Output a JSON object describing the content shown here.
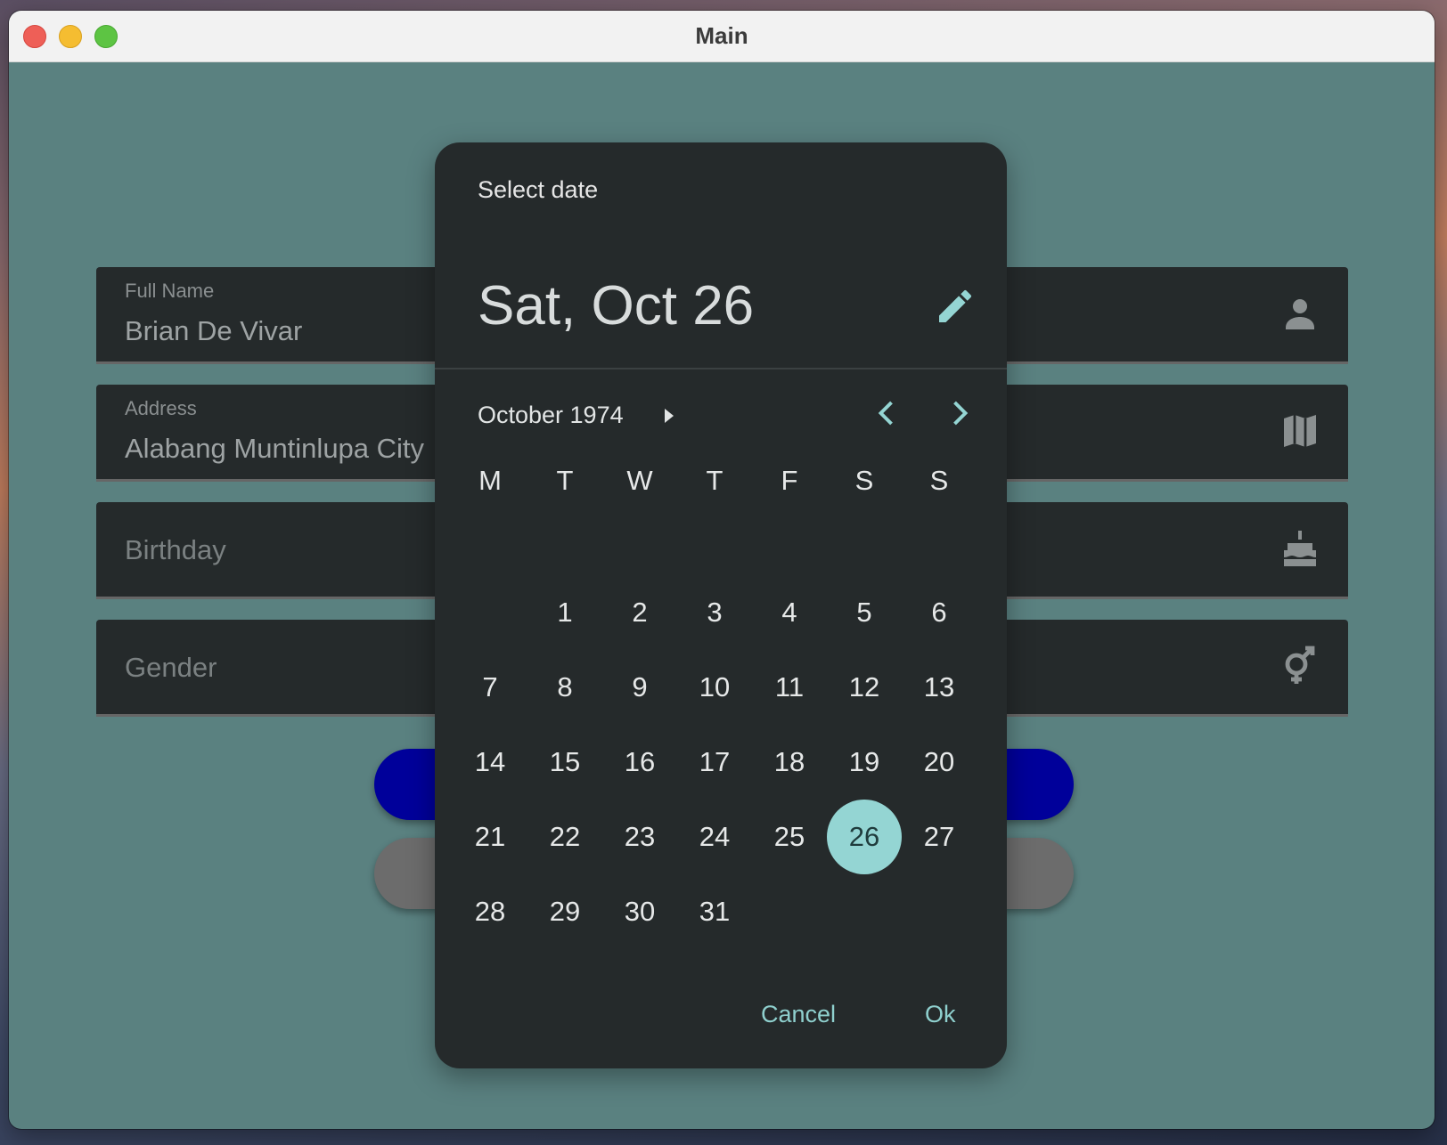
{
  "window": {
    "title": "Main"
  },
  "form": {
    "full_name": {
      "label": "Full Name",
      "value": "Brian De Vivar",
      "icon": "person-icon"
    },
    "address": {
      "label": "Address",
      "value": "Alabang Muntinlupa City",
      "icon": "map-icon"
    },
    "birthday": {
      "placeholder": "Birthday",
      "icon": "cake-icon"
    },
    "gender": {
      "placeholder": "Gender",
      "icon": "gender-icon"
    }
  },
  "date_picker": {
    "title": "Select date",
    "selected_display": "Sat, Oct 26",
    "month_year": "October 1974",
    "weekdays": [
      "M",
      "T",
      "W",
      "T",
      "F",
      "S",
      "S"
    ],
    "first_weekday_index": 1,
    "days_in_month": 31,
    "selected_day": 26,
    "cancel_label": "Cancel",
    "ok_label": "Ok",
    "accent_color": "#94d5d3"
  },
  "colors": {
    "window_bg": "#5a8180",
    "surface": "#252a2b",
    "primary_button": "#00009a",
    "secondary_button": "#6c6c6c"
  }
}
